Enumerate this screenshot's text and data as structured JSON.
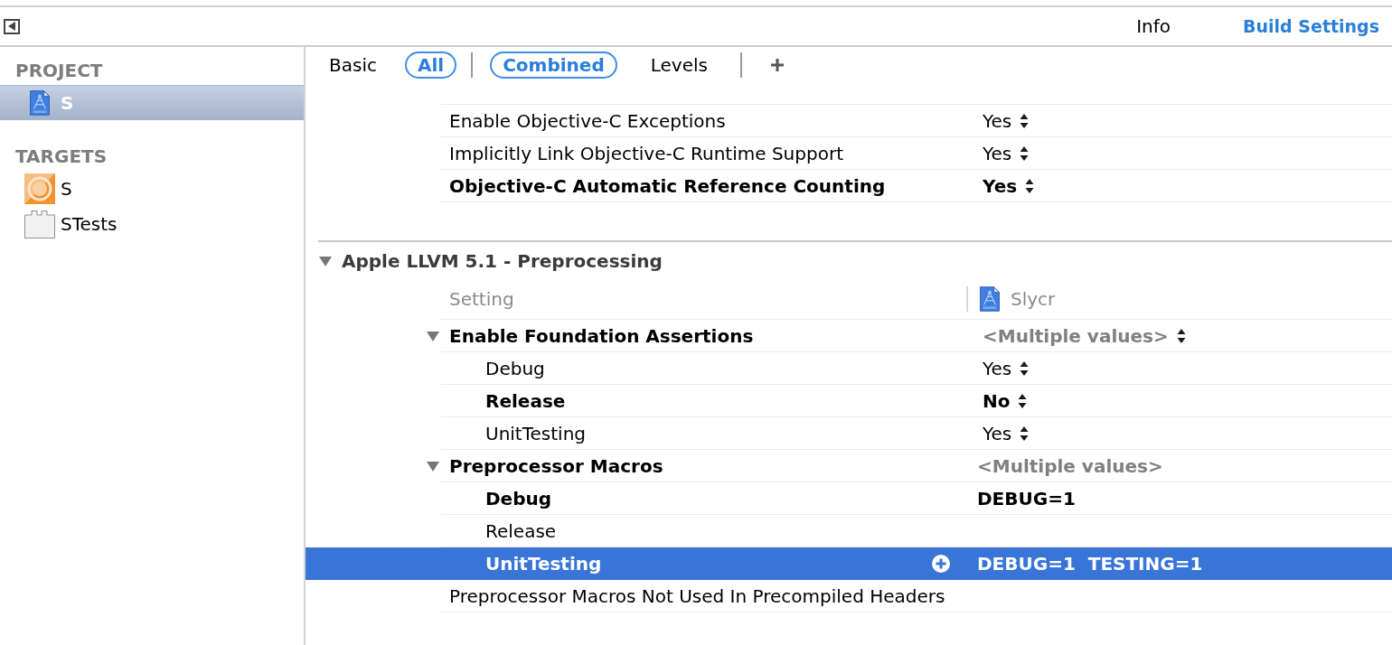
{
  "toolbar": {
    "tabs": [
      {
        "label": "Info",
        "selected": false
      },
      {
        "label": "Build Settings",
        "selected": true
      }
    ]
  },
  "sidebar": {
    "sections": [
      {
        "title": "PROJECT",
        "items": [
          {
            "label": "S",
            "kind": "project",
            "selected": true
          }
        ]
      },
      {
        "title": "TARGETS",
        "items": [
          {
            "label": "S",
            "kind": "app",
            "selected": false
          },
          {
            "label": "STests",
            "kind": "tests",
            "selected": false
          }
        ]
      }
    ]
  },
  "filter_bar": {
    "scopes": [
      {
        "label": "Basic",
        "selected": false
      },
      {
        "label": "All",
        "selected": true
      }
    ],
    "views": [
      {
        "label": "Combined",
        "selected": true
      },
      {
        "label": "Levels",
        "selected": false
      }
    ]
  },
  "groups": [
    {
      "rows": [
        {
          "name": "Enable Objective-C Exceptions",
          "customized": false,
          "selected": false,
          "kind": "popup",
          "value": "Yes"
        },
        {
          "name": "Implicitly Link Objective-C Runtime Support",
          "customized": false,
          "selected": false,
          "kind": "popup",
          "value": "Yes"
        },
        {
          "name": "Objective-C Automatic Reference Counting",
          "customized": true,
          "selected": false,
          "kind": "popup",
          "value": "Yes"
        }
      ]
    },
    {
      "title": "Apple LLVM 5.1 - Preprocessing",
      "expanded": true,
      "columns": {
        "setting": "Setting",
        "target": "Slycr"
      },
      "rows": [
        {
          "name": "Enable Foundation Assertions",
          "customized": true,
          "selected": false,
          "kind": "popup",
          "value": "<Multiple values>",
          "expanded": true,
          "children": [
            {
              "name": "Debug",
              "customized": false,
              "selected": false,
              "kind": "popup",
              "value": "Yes"
            },
            {
              "name": "Release",
              "customized": true,
              "selected": false,
              "kind": "popup",
              "value": "No"
            },
            {
              "name": "UnitTesting",
              "customized": false,
              "selected": false,
              "kind": "popup",
              "value": "Yes"
            }
          ]
        },
        {
          "name": "Preprocessor Macros",
          "customized": true,
          "selected": false,
          "kind": "text",
          "value": "<Multiple values>",
          "expanded": true,
          "children": [
            {
              "name": "Debug",
              "customized": true,
              "selected": false,
              "kind": "text",
              "value": "DEBUG=1"
            },
            {
              "name": "Release",
              "customized": false,
              "selected": false
            },
            {
              "name": "UnitTesting",
              "customized": true,
              "selected": true,
              "kind": "text",
              "value": "DEBUG=1  TESTING=1"
            }
          ]
        },
        {
          "name": "Preprocessor Macros Not Used In Precompiled Headers",
          "customized": false,
          "selected": false
        }
      ]
    }
  ]
}
